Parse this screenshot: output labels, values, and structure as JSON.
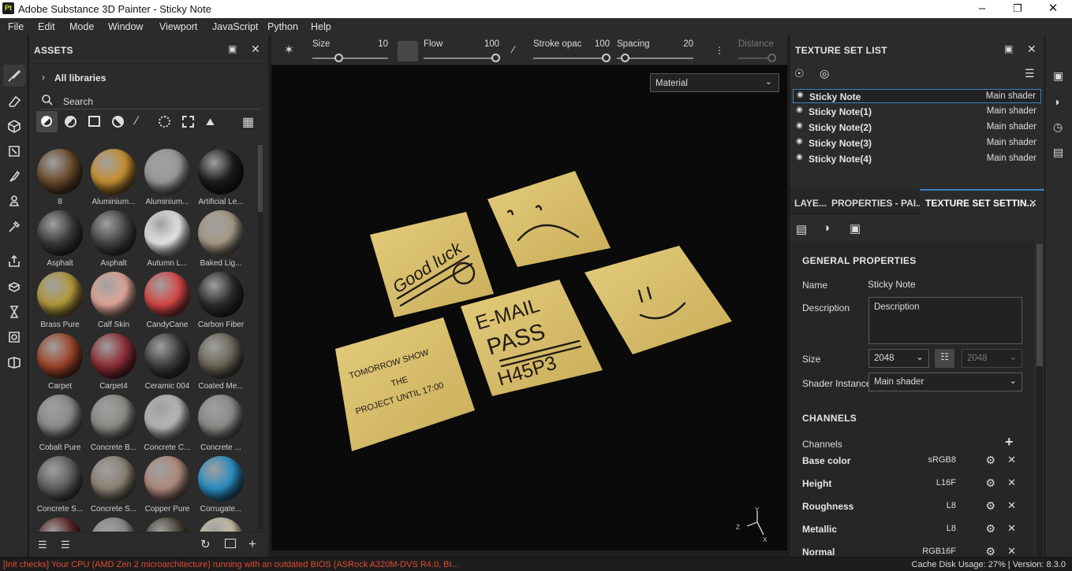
{
  "window": {
    "title": "Adobe Substance 3D Painter - Sticky Note",
    "logo": "Pt"
  },
  "menu": [
    "File",
    "Edit",
    "Mode",
    "Window",
    "Viewport",
    "JavaScript",
    "Python",
    "Help"
  ],
  "assets": {
    "title": "ASSETS",
    "library": "All libraries",
    "search_placeholder": "Search",
    "items": [
      {
        "name": "8",
        "color": "#6b4a2c"
      },
      {
        "name": "Aluminium...",
        "color": "#c89030"
      },
      {
        "name": "Aluminium...",
        "color": "#9a9a9a"
      },
      {
        "name": "Artificial Le...",
        "color": "#1c1c1c"
      },
      {
        "name": "Asphalt",
        "color": "#3a3a3a"
      },
      {
        "name": "Asphalt",
        "color": "#444444"
      },
      {
        "name": "Autumn L...",
        "color": "#e8e8e8"
      },
      {
        "name": "Baked Lig...",
        "color": "#a89a86"
      },
      {
        "name": "Brass Pure",
        "color": "#b39a3c"
      },
      {
        "name": "Calf Skin",
        "color": "#e2a79a"
      },
      {
        "name": "CandyCane",
        "color": "#d94848"
      },
      {
        "name": "Carbon Fiber",
        "color": "#2c2c2c"
      },
      {
        "name": "Carpet",
        "color": "#a0452a"
      },
      {
        "name": "Carpet4",
        "color": "#8e2e36"
      },
      {
        "name": "Ceramic 004",
        "color": "#3c3c3c"
      },
      {
        "name": "Coated Me...",
        "color": "#6a6556"
      },
      {
        "name": "Cobalt Pure",
        "color": "#8a8a8a"
      },
      {
        "name": "Concrete B...",
        "color": "#8c8a84"
      },
      {
        "name": "Concrete C...",
        "color": "#b8b8b8"
      },
      {
        "name": "Concrete ...",
        "color": "#8a8a86"
      },
      {
        "name": "Concrete S...",
        "color": "#5e5e5e"
      },
      {
        "name": "Concrete S...",
        "color": "#8c8274"
      },
      {
        "name": "Copper Pure",
        "color": "#b08a7c"
      },
      {
        "name": "Corrugate...",
        "color": "#2a8ec2"
      },
      {
        "name": "",
        "color": "#5a2424"
      },
      {
        "name": "",
        "color": "#8a8a8a"
      },
      {
        "name": "",
        "color": "#4a4238"
      },
      {
        "name": "",
        "color": "#c8c0a8"
      }
    ]
  },
  "toolprops": {
    "size_label": "Size",
    "size_value": "10",
    "flow_label": "Flow",
    "flow_value": "100",
    "stroke_label": "Stroke opac",
    "stroke_value": "100",
    "spacing_label": "Spacing",
    "spacing_value": "20",
    "distance_label": "Distance"
  },
  "viewport": {
    "mode": "Material"
  },
  "texture_set_list": {
    "title": "TEXTURE SET LIST",
    "sets": [
      {
        "name": "Sticky Note",
        "shader": "Main shader"
      },
      {
        "name": "Sticky Note(1)",
        "shader": "Main shader"
      },
      {
        "name": "Sticky Note(2)",
        "shader": "Main shader"
      },
      {
        "name": "Sticky Note(3)",
        "shader": "Main shader"
      },
      {
        "name": "Sticky Note(4)",
        "shader": "Main shader"
      }
    ]
  },
  "tabs": {
    "layers": "LAYE...",
    "properties": "PROPERTIES - PAI...",
    "texset": "TEXTURE SET SETTIN..."
  },
  "general": {
    "title": "GENERAL PROPERTIES",
    "name_label": "Name",
    "name_value": "Sticky Note",
    "desc_label": "Description",
    "desc_value": "Description",
    "size_label": "Size",
    "size_value": "2048",
    "size_value2": "2048",
    "shader_label": "Shader Instance",
    "shader_value": "Main shader"
  },
  "channels": {
    "title": "CHANNELS",
    "label": "Channels",
    "items": [
      {
        "name": "Base color",
        "format": "sRGB8"
      },
      {
        "name": "Height",
        "format": "L16F"
      },
      {
        "name": "Roughness",
        "format": "L8"
      },
      {
        "name": "Metallic",
        "format": "L8"
      },
      {
        "name": "Normal",
        "format": "RGB16F"
      }
    ]
  },
  "status": {
    "message": "[Init checks] Your CPU (AMD Zen 2 microarchitecture) running with an outdated BIOS (ASRock A320M-DVS R4.0, BI...",
    "cache": "Cache Disk Usage:   27% | Version: 8.3.0"
  },
  "notes": {
    "note1": "Good luck",
    "note3a": "E-MAIL",
    "note3b": "PASS",
    "note3c": "H45P3",
    "note5a": "TOMORROW SHOW",
    "note5b": "THE",
    "note5c": "PROJECT UNTIL 17:00"
  }
}
